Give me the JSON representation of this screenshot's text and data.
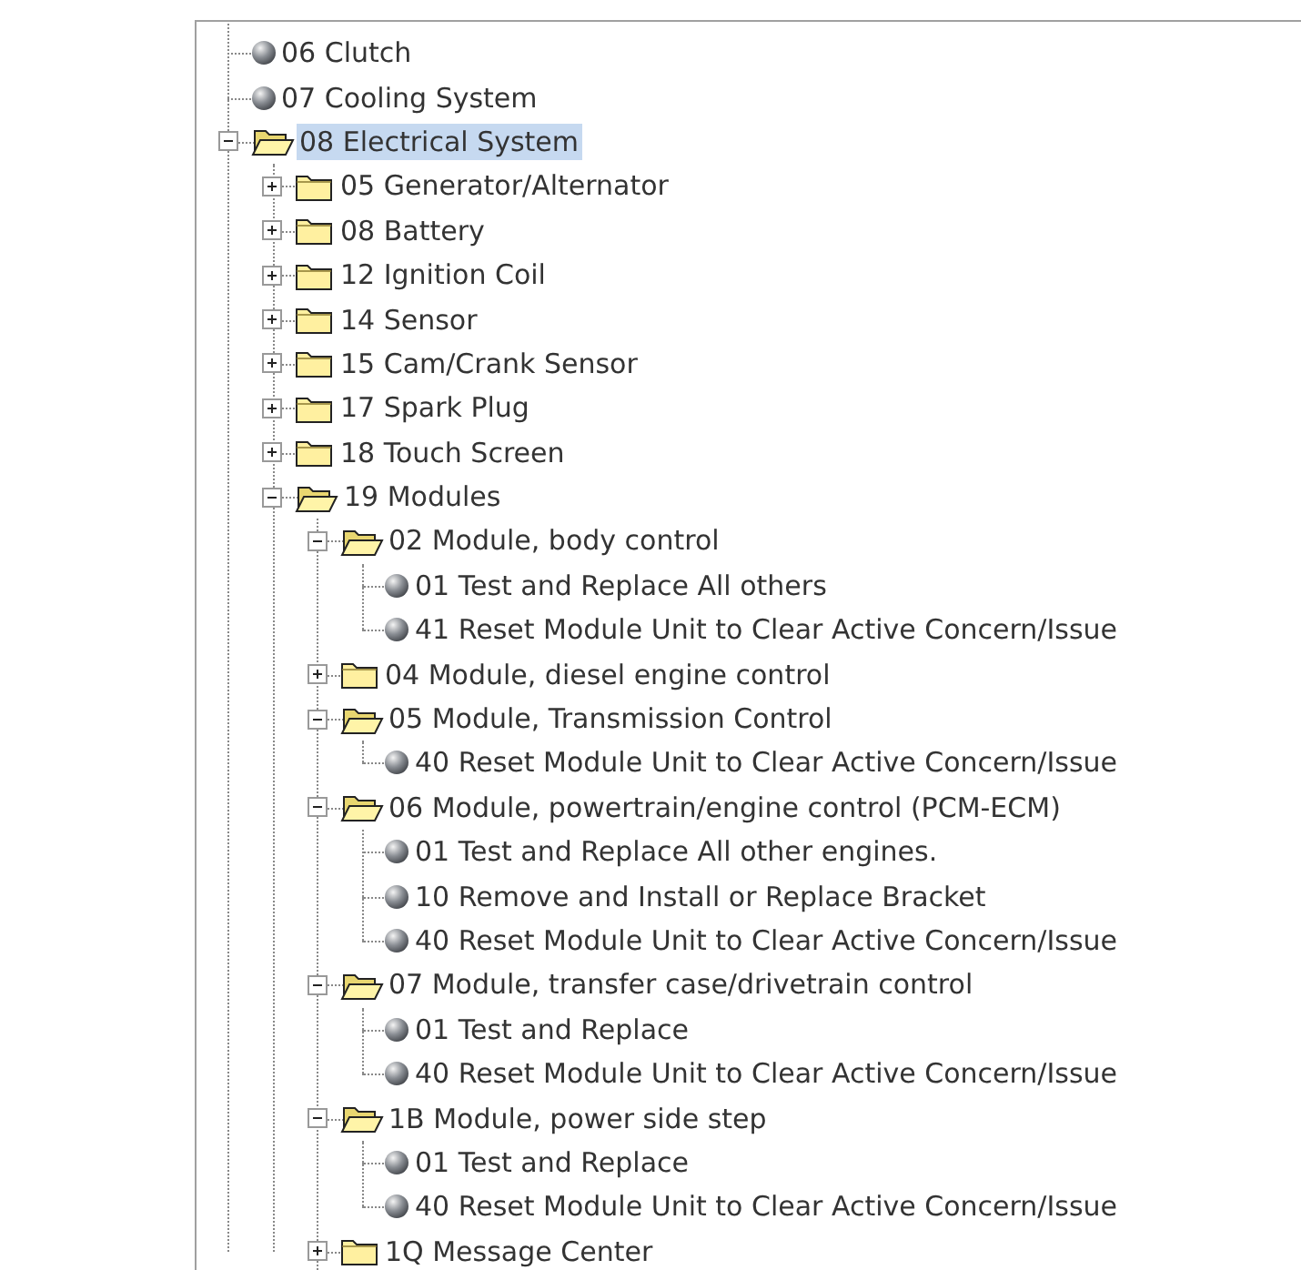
{
  "tree": [
    {
      "label": "06 Clutch",
      "kind": "leaf",
      "selected": false
    },
    {
      "label": "07 Cooling System",
      "kind": "leaf",
      "selected": false
    },
    {
      "label": "08 Electrical System",
      "kind": "folder",
      "expanded": true,
      "selected": true,
      "children": [
        {
          "label": "05 Generator/Alternator",
          "kind": "folder",
          "expanded": false,
          "selected": false
        },
        {
          "label": "08 Battery",
          "kind": "folder",
          "expanded": false,
          "selected": false
        },
        {
          "label": "12 Ignition Coil",
          "kind": "folder",
          "expanded": false,
          "selected": false
        },
        {
          "label": "14 Sensor",
          "kind": "folder",
          "expanded": false,
          "selected": false
        },
        {
          "label": "15 Cam/Crank Sensor",
          "kind": "folder",
          "expanded": false,
          "selected": false
        },
        {
          "label": "17 Spark Plug",
          "kind": "folder",
          "expanded": false,
          "selected": false
        },
        {
          "label": "18 Touch Screen",
          "kind": "folder",
          "expanded": false,
          "selected": false
        },
        {
          "label": "19 Modules",
          "kind": "folder",
          "expanded": true,
          "selected": false,
          "children": [
            {
              "label": "02 Module, body control",
              "kind": "folder",
              "expanded": true,
              "selected": false,
              "children": [
                {
                  "label": "01 Test and Replace All others",
                  "kind": "leaf",
                  "selected": false
                },
                {
                  "label": "41 Reset Module Unit to Clear Active Concern/Issue",
                  "kind": "leaf",
                  "selected": false
                }
              ]
            },
            {
              "label": "04 Module, diesel engine control",
              "kind": "folder",
              "expanded": false,
              "selected": false
            },
            {
              "label": "05 Module, Transmission Control",
              "kind": "folder",
              "expanded": true,
              "selected": false,
              "children": [
                {
                  "label": "40 Reset Module Unit to Clear Active Concern/Issue",
                  "kind": "leaf",
                  "selected": false
                }
              ]
            },
            {
              "label": "06 Module, powertrain/engine control (PCM-ECM)",
              "kind": "folder",
              "expanded": true,
              "selected": false,
              "children": [
                {
                  "label": "01 Test and Replace All other engines.",
                  "kind": "leaf",
                  "selected": false
                },
                {
                  "label": "10 Remove and Install or Replace Bracket",
                  "kind": "leaf",
                  "selected": false
                },
                {
                  "label": "40 Reset Module Unit to Clear Active Concern/Issue",
                  "kind": "leaf",
                  "selected": false
                }
              ]
            },
            {
              "label": "07 Module, transfer case/drivetrain control",
              "kind": "folder",
              "expanded": true,
              "selected": false,
              "children": [
                {
                  "label": "01 Test and Replace",
                  "kind": "leaf",
                  "selected": false
                },
                {
                  "label": "40 Reset Module Unit to Clear Active Concern/Issue",
                  "kind": "leaf",
                  "selected": false
                }
              ]
            },
            {
              "label": "1B Module, power side step",
              "kind": "folder",
              "expanded": true,
              "selected": false,
              "children": [
                {
                  "label": "01 Test and Replace",
                  "kind": "leaf",
                  "selected": false
                },
                {
                  "label": "40 Reset Module Unit to Clear Active Concern/Issue",
                  "kind": "leaf",
                  "selected": false
                }
              ]
            },
            {
              "label": "1Q Message Center",
              "kind": "folder",
              "expanded": false,
              "selected": false
            }
          ]
        }
      ]
    }
  ]
}
